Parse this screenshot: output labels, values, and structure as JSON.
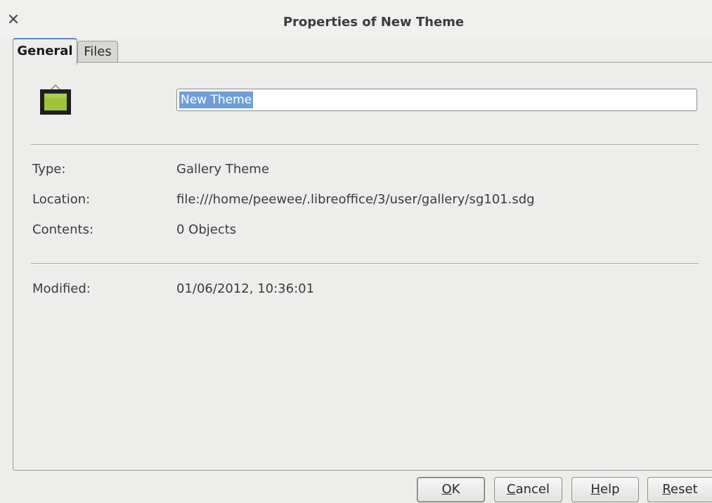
{
  "window": {
    "title": "Properties of New Theme",
    "close_glyph": "×"
  },
  "tabs": [
    {
      "label": "General",
      "active": true
    },
    {
      "label": "Files",
      "active": false
    }
  ],
  "general": {
    "icon": "gallery-theme-icon",
    "name_value": "New Theme",
    "type_label": "Type:",
    "type_value": "Gallery Theme",
    "location_label": "Location:",
    "location_value": "file:///home/peewee/.libreoffice/3/user/gallery/sg101.sdg",
    "contents_label": "Contents:",
    "contents_value": "0 Objects",
    "modified_label": "Modified:",
    "modified_value": "01/06/2012, 10:36:01"
  },
  "buttons": {
    "ok": {
      "mnemonic": "O",
      "rest": "K"
    },
    "cancel": {
      "mnemonic": "C",
      "rest": "ancel"
    },
    "help": {
      "mnemonic": "H",
      "rest": "elp"
    },
    "reset": {
      "mnemonic": "R",
      "rest": "eset"
    }
  },
  "colors": {
    "selection": "#6e9fd9",
    "icon_screen": "#9bc43a"
  }
}
